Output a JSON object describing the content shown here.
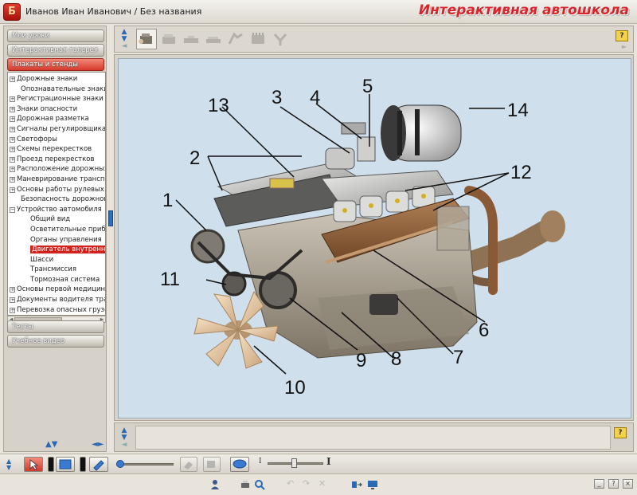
{
  "window": {
    "title": "Иванов Иван Иванович / Без названия",
    "brand": "Интерактивная автошкола",
    "logo_letter": "Б"
  },
  "sidebar": {
    "top_buttons": [
      "Мои уроки",
      "Интерактивная галерея",
      "Плакаты и стенды"
    ],
    "active_button": "Плакаты и стенды",
    "tree": [
      {
        "label": "Дорожные знаки",
        "level": 0,
        "expander": "+"
      },
      {
        "label": "Опознавательные знаки тр",
        "level": 0,
        "expander": ""
      },
      {
        "label": "Регистрационные знаки тр",
        "level": 0,
        "expander": "+"
      },
      {
        "label": "Знаки опасности",
        "level": 0,
        "expander": "+"
      },
      {
        "label": "Дорожная разметка",
        "level": 0,
        "expander": "+"
      },
      {
        "label": "Сигналы регулировщика",
        "level": 0,
        "expander": "+"
      },
      {
        "label": "Светофоры",
        "level": 0,
        "expander": "+"
      },
      {
        "label": "Схемы перекрестков",
        "level": 0,
        "expander": "+"
      },
      {
        "label": "Проезд перекрестков",
        "level": 0,
        "expander": "+"
      },
      {
        "label": "Расположение дорожных з",
        "level": 0,
        "expander": "+"
      },
      {
        "label": "Маневрирование транспор",
        "level": 0,
        "expander": "+"
      },
      {
        "label": "Основы работы рулевых к",
        "level": 0,
        "expander": "+"
      },
      {
        "label": "Безопасность дорожного д",
        "level": 0,
        "expander": ""
      },
      {
        "label": "Устройство автомобиля",
        "level": 0,
        "expander": "−"
      },
      {
        "label": "Общий вид",
        "level": 1,
        "expander": ""
      },
      {
        "label": "Осветительные прибор",
        "level": 1,
        "expander": ""
      },
      {
        "label": "Органы управления",
        "level": 1,
        "expander": ""
      },
      {
        "label": "Двигатель внутреннего",
        "level": 1,
        "expander": "",
        "selected": true
      },
      {
        "label": "Шасси",
        "level": 1,
        "expander": ""
      },
      {
        "label": "Трансмиссия",
        "level": 1,
        "expander": ""
      },
      {
        "label": "Тормозная система",
        "level": 1,
        "expander": ""
      },
      {
        "label": "Основы первой медицинск",
        "level": 0,
        "expander": "+"
      },
      {
        "label": "Документы водителя транс",
        "level": 0,
        "expander": "+"
      },
      {
        "label": "Перевозка опасных грузов",
        "level": 0,
        "expander": "+"
      }
    ],
    "bottom_buttons": [
      "Тесты",
      "Учебное видео"
    ]
  },
  "poster": {
    "callouts": [
      "1",
      "2",
      "3",
      "4",
      "5",
      "6",
      "7",
      "8",
      "9",
      "10",
      "11",
      "12",
      "13",
      "14"
    ]
  },
  "toolbar": {
    "text_size_small": "I",
    "text_size_large": "I",
    "help_label": "?"
  },
  "colors": {
    "accent_red": "#d2201a",
    "poster_bg": "#cfe0ec",
    "nav_blue": "#2a69b5"
  }
}
